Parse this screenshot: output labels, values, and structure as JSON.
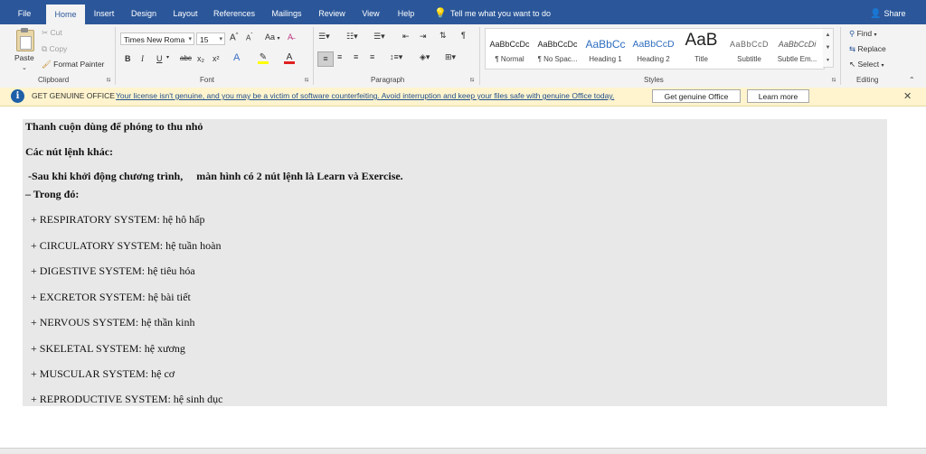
{
  "tabs": [
    "File",
    "Home",
    "Insert",
    "Design",
    "Layout",
    "References",
    "Mailings",
    "Review",
    "View",
    "Help"
  ],
  "active_tab": "Home",
  "tell_me": "Tell me what you want to do",
  "share": "Share",
  "clipboard": {
    "paste": "Paste",
    "cut": "Cut",
    "copy": "Copy",
    "format_painter": "Format Painter",
    "label": "Clipboard"
  },
  "font": {
    "name": "Times New Roma",
    "size": "15",
    "grow": "A",
    "shrink": "A",
    "case": "Aa",
    "bold": "B",
    "italic": "I",
    "underline": "U",
    "strike": "abc",
    "subscript": "x₂",
    "superscript": "x²",
    "label": "Font"
  },
  "paragraph": {
    "label": "Paragraph"
  },
  "styles": {
    "items": [
      {
        "preview": "AaBbCcDc",
        "name": "¶ Normal"
      },
      {
        "preview": "AaBbCcDc",
        "name": "¶ No Spac..."
      },
      {
        "preview": "AaBbCc",
        "name": "Heading 1"
      },
      {
        "preview": "AaBbCcD",
        "name": "Heading 2"
      },
      {
        "preview": "AaB",
        "name": "Title"
      },
      {
        "preview": "AaBbCcD",
        "name": "Subtitle"
      },
      {
        "preview": "AaBbCcDi",
        "name": "Subtle Em..."
      }
    ],
    "label": "Styles"
  },
  "editing": {
    "find": "Find",
    "replace": "Replace",
    "select": "Select",
    "label": "Editing"
  },
  "warning": {
    "title": "GET GENUINE OFFICE",
    "message": "Your license isn't genuine, and you may be a victim of software counterfeiting. Avoid interruption and keep your files safe with genuine Office today.",
    "primary_button": "Get genuine Office",
    "secondary_button": "Learn more"
  },
  "document": {
    "lines": [
      {
        "text": "Thanh cuộn dùng để phóng to thu nhỏ",
        "bold": true
      },
      {
        "text": "Các nút lệnh khác:",
        "bold": true
      },
      {
        "text": " -Sau khi khởi động chương trình,     màn hình có 2 nút lệnh là Learn và Exercise.",
        "bold": true
      },
      {
        "text": "– Trong đó:",
        "bold": true
      },
      {
        "text": "  + RESPIRATORY SYSTEM: hệ hô hấp",
        "bold": false
      },
      {
        "text": "  + CIRCULATORY SYSTEM: hệ tuần hoàn",
        "bold": false
      },
      {
        "text": "  + DIGESTIVE SYSTEM: hệ tiêu hóa",
        "bold": false
      },
      {
        "text": "  + EXCRETOR SYSTEM: hệ bài tiết",
        "bold": false
      },
      {
        "text": "  + NERVOUS SYSTEM: hệ thần kinh",
        "bold": false
      },
      {
        "text": "  + SKELETAL SYSTEM: hệ xương",
        "bold": false
      },
      {
        "text": "  + MUSCULAR SYSTEM: hệ cơ",
        "bold": false
      },
      {
        "text": "  + REPRODUCTIVE SYSTEM: hệ sinh dục",
        "bold": false
      }
    ]
  },
  "colors": {
    "ribbon_blue": "#2b579a",
    "warning_bg": "#fff4ce",
    "font_color_red": "#e02020",
    "highlight_yellow": "#ffff00"
  }
}
